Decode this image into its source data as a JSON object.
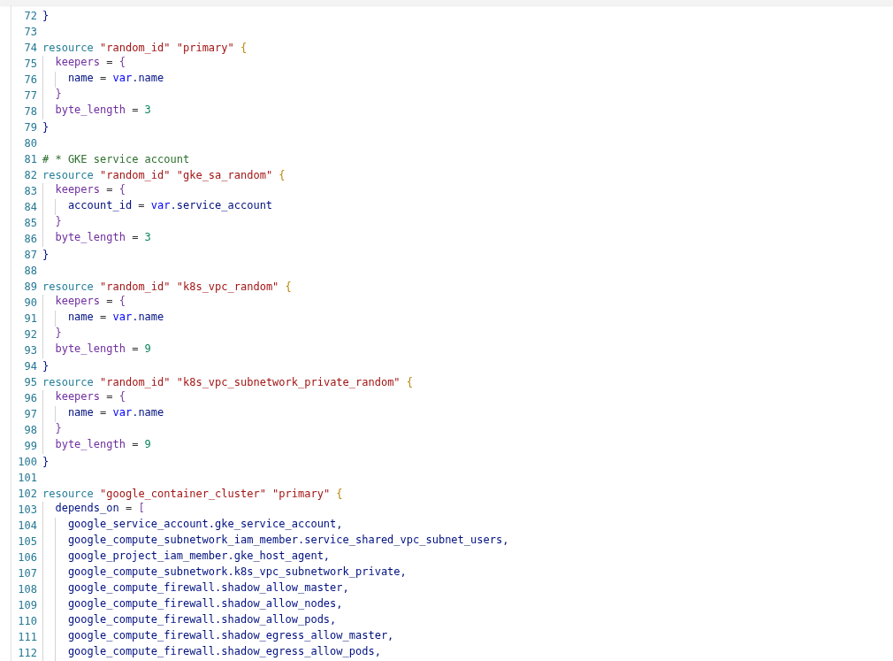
{
  "editor": {
    "lines": [
      {
        "number": "72",
        "tokens": [
          {
            "kind": "brace",
            "text": "}"
          }
        ]
      },
      {
        "number": "73"
      },
      {
        "number": "74",
        "tokens": [
          {
            "kind": "keyword",
            "text": "resource "
          },
          {
            "kind": "string",
            "text": "\"random_id\" "
          },
          {
            "kind": "string",
            "text": "\"primary\" "
          },
          {
            "kind": "bracket",
            "text": "{"
          }
        ]
      },
      {
        "number": "75",
        "tokens": [
          {
            "kind": "property",
            "text": "  keepers"
          },
          {
            "kind": "plain",
            "text": " = "
          },
          {
            "kind": "bracket2",
            "text": "{"
          }
        ]
      },
      {
        "number": "76",
        "tokens": [
          {
            "kind": "name",
            "text": "    name"
          },
          {
            "kind": "plain",
            "text": " = "
          },
          {
            "kind": "var",
            "text": "var"
          },
          {
            "kind": "name",
            "text": ".name"
          }
        ]
      },
      {
        "number": "77",
        "tokens": [
          {
            "kind": "bracket2",
            "text": "  }"
          }
        ]
      },
      {
        "number": "78",
        "tokens": [
          {
            "kind": "property",
            "text": "  byte_length"
          },
          {
            "kind": "plain",
            "text": " = "
          },
          {
            "kind": "number",
            "text": "3"
          }
        ]
      },
      {
        "number": "79",
        "tokens": [
          {
            "kind": "brace",
            "text": "}"
          }
        ]
      },
      {
        "number": "80"
      },
      {
        "number": "81",
        "tokens": [
          {
            "kind": "comment",
            "text": "# * GKE service account"
          }
        ]
      },
      {
        "number": "82",
        "tokens": [
          {
            "kind": "keyword",
            "text": "resource "
          },
          {
            "kind": "string",
            "text": "\"random_id\" "
          },
          {
            "kind": "string",
            "text": "\"gke_sa_random\" "
          },
          {
            "kind": "bracket",
            "text": "{"
          }
        ]
      },
      {
        "number": "83",
        "tokens": [
          {
            "kind": "property",
            "text": "  keepers"
          },
          {
            "kind": "plain",
            "text": " = "
          },
          {
            "kind": "bracket2",
            "text": "{"
          }
        ]
      },
      {
        "number": "84",
        "tokens": [
          {
            "kind": "name",
            "text": "    account_id"
          },
          {
            "kind": "plain",
            "text": " = "
          },
          {
            "kind": "var",
            "text": "var"
          },
          {
            "kind": "name",
            "text": ".service_account"
          }
        ]
      },
      {
        "number": "85",
        "tokens": [
          {
            "kind": "bracket2",
            "text": "  }"
          }
        ]
      },
      {
        "number": "86",
        "tokens": [
          {
            "kind": "property",
            "text": "  byte_length"
          },
          {
            "kind": "plain",
            "text": " = "
          },
          {
            "kind": "number",
            "text": "3"
          }
        ]
      },
      {
        "number": "87",
        "tokens": [
          {
            "kind": "brace",
            "text": "}"
          }
        ]
      },
      {
        "number": "88"
      },
      {
        "number": "89",
        "tokens": [
          {
            "kind": "keyword",
            "text": "resource "
          },
          {
            "kind": "string",
            "text": "\"random_id\" "
          },
          {
            "kind": "string",
            "text": "\"k8s_vpc_random\" "
          },
          {
            "kind": "bracket",
            "text": "{"
          }
        ]
      },
      {
        "number": "90",
        "tokens": [
          {
            "kind": "property",
            "text": "  keepers"
          },
          {
            "kind": "plain",
            "text": " = "
          },
          {
            "kind": "bracket2",
            "text": "{"
          }
        ]
      },
      {
        "number": "91",
        "tokens": [
          {
            "kind": "name",
            "text": "    name"
          },
          {
            "kind": "plain",
            "text": " = "
          },
          {
            "kind": "var",
            "text": "var"
          },
          {
            "kind": "name",
            "text": ".name"
          }
        ]
      },
      {
        "number": "92",
        "tokens": [
          {
            "kind": "bracket2",
            "text": "  }"
          }
        ]
      },
      {
        "number": "93",
        "tokens": [
          {
            "kind": "property",
            "text": "  byte_length"
          },
          {
            "kind": "plain",
            "text": " = "
          },
          {
            "kind": "number",
            "text": "9"
          }
        ]
      },
      {
        "number": "94",
        "tokens": [
          {
            "kind": "brace",
            "text": "}"
          }
        ]
      },
      {
        "number": "95",
        "tokens": [
          {
            "kind": "keyword",
            "text": "resource "
          },
          {
            "kind": "string",
            "text": "\"random_id\" "
          },
          {
            "kind": "string",
            "text": "\"k8s_vpc_subnetwork_private_random\" "
          },
          {
            "kind": "bracket",
            "text": "{"
          }
        ]
      },
      {
        "number": "96",
        "tokens": [
          {
            "kind": "property",
            "text": "  keepers"
          },
          {
            "kind": "plain",
            "text": " = "
          },
          {
            "kind": "bracket2",
            "text": "{"
          }
        ]
      },
      {
        "number": "97",
        "tokens": [
          {
            "kind": "name",
            "text": "    name"
          },
          {
            "kind": "plain",
            "text": " = "
          },
          {
            "kind": "var",
            "text": "var"
          },
          {
            "kind": "name",
            "text": ".name"
          }
        ]
      },
      {
        "number": "98",
        "tokens": [
          {
            "kind": "bracket2",
            "text": "  }"
          }
        ]
      },
      {
        "number": "99",
        "tokens": [
          {
            "kind": "property",
            "text": "  byte_length"
          },
          {
            "kind": "plain",
            "text": " = "
          },
          {
            "kind": "number",
            "text": "9"
          }
        ]
      },
      {
        "number": "100",
        "tokens": [
          {
            "kind": "brace",
            "text": "}"
          }
        ]
      },
      {
        "number": "101"
      },
      {
        "number": "102",
        "tokens": [
          {
            "kind": "keyword",
            "text": "resource "
          },
          {
            "kind": "string",
            "text": "\"google_container_cluster\" "
          },
          {
            "kind": "string",
            "text": "\"primary\" "
          },
          {
            "kind": "bracket",
            "text": "{"
          }
        ]
      },
      {
        "number": "103",
        "tokens": [
          {
            "kind": "name",
            "text": "  depends_on"
          },
          {
            "kind": "plain",
            "text": " = "
          },
          {
            "kind": "bracket2",
            "text": "["
          }
        ]
      },
      {
        "number": "104",
        "tokens": [
          {
            "kind": "name",
            "text": "    google_service_account.gke_service_account,"
          }
        ]
      },
      {
        "number": "105",
        "tokens": [
          {
            "kind": "name",
            "text": "    google_compute_subnetwork_iam_member.service_shared_vpc_subnet_users,"
          }
        ]
      },
      {
        "number": "106",
        "tokens": [
          {
            "kind": "name",
            "text": "    google_project_iam_member.gke_host_agent,"
          }
        ]
      },
      {
        "number": "107",
        "tokens": [
          {
            "kind": "name",
            "text": "    google_compute_subnetwork.k8s_vpc_subnetwork_private,"
          }
        ]
      },
      {
        "number": "108",
        "tokens": [
          {
            "kind": "name",
            "text": "    google_compute_firewall.shadow_allow_master,"
          }
        ]
      },
      {
        "number": "109",
        "tokens": [
          {
            "kind": "name",
            "text": "    google_compute_firewall.shadow_allow_nodes,"
          }
        ]
      },
      {
        "number": "110",
        "tokens": [
          {
            "kind": "name",
            "text": "    google_compute_firewall.shadow_allow_pods,"
          }
        ]
      },
      {
        "number": "111",
        "tokens": [
          {
            "kind": "name",
            "text": "    google_compute_firewall.shadow_egress_allow_master,"
          }
        ]
      },
      {
        "number": "112",
        "tokens": [
          {
            "kind": "name",
            "text": "    google_compute_firewall.shadow_egress_allow_pods,"
          }
        ]
      }
    ]
  }
}
